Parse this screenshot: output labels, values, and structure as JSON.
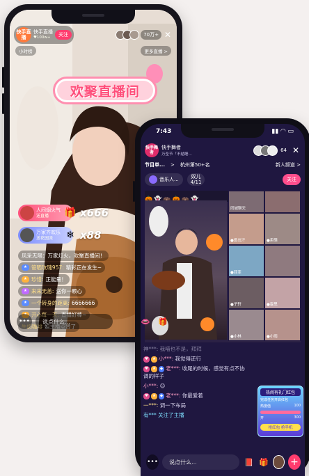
{
  "phone_a": {
    "anchor_name": "快手直播",
    "anchor_sub": "♥100w+",
    "avatar_text": "快手直播",
    "follow_label": "关注",
    "viewer_count": "70万+",
    "hour_rank": "小时榜",
    "more_live": "更多直播 >",
    "banner_text": "欢聚直播间",
    "gifts": [
      {
        "name": "人间烟火气",
        "sub": "送直播",
        "count": "x666",
        "icon": "gift-icon"
      },
      {
        "name": "万家齐欢乐",
        "sub": "送花园派",
        "count": "x88",
        "icon": "snowflake-icon"
      }
    ],
    "chat": [
      {
        "level": "",
        "user": "",
        "text": "风采无限：万家灯火，欢聚直播间！"
      },
      {
        "level": "",
        "user": "管晒玫瑰957:",
        "text": "精彩正在发生~"
      },
      {
        "level": "",
        "user": "珍惜:",
        "text": "正能量！"
      },
      {
        "level": "",
        "user": "来来无恙:",
        "text": "送你一颗心"
      },
      {
        "level": "",
        "user": "一个转身的距离:",
        "text": "6666666"
      },
      {
        "level": "",
        "user": "开心每一天:",
        "text": "直播好棒~"
      },
      {
        "level": "",
        "user": "牛奶咖啡",
        "text": "姐主播点赞了"
      }
    ],
    "input_placeholder": "说点什么..."
  },
  "phone_b": {
    "time": "7:43",
    "anchor_name": "快手舞者",
    "anchor_sub": "万圣节「不结睡...",
    "avatar_text": "快手舞者",
    "viewer_num": "64",
    "tabs": [
      "节目单...",
      ">",
      "杭州第50+名",
      "新人频道 >"
    ],
    "row3": {
      "room_label": "音乐人...",
      "chip_title": "奴儿",
      "chip_date": "4/11",
      "follow": "关注"
    },
    "grid_tiles": [
      {
        "label": "同城聊天"
      },
      {
        "label": ""
      },
      {
        "label": "●爱出汗"
      },
      {
        "label": "●卖萌"
      },
      {
        "label": "●菲菲"
      },
      {
        "label": ""
      },
      {
        "label": "●子轩"
      },
      {
        "label": "●姿思"
      },
      {
        "label": "●小林"
      },
      {
        "label": "●小雨"
      }
    ],
    "chat": [
      {
        "type": "faded",
        "text": "神***: 我喵也不是，拜拜"
      },
      {
        "type": "lv",
        "user": "小***:",
        "text": "我觉得还行"
      },
      {
        "type": "lv",
        "user": "老***:",
        "text": "收尾的时候，感觉有点不协调的样子"
      },
      {
        "type": "lv",
        "user": "小***:",
        "text": "😊"
      },
      {
        "type": "lv",
        "user": "老***:",
        "text": "你最爱着"
      },
      {
        "type": "plain",
        "user": "一***:",
        "text": "调一下布局"
      },
      {
        "type": "sys",
        "user": "有***",
        "text": "关注了主播"
      }
    ],
    "rank_card": {
      "title": "热闹有礼门红包",
      "line1": "完成任务开启红包",
      "label_a": "热度值",
      "val_a": "100",
      "label_b": "开",
      "val_b": "300",
      "btn": "抢红包 抢手机"
    },
    "input_placeholder": "说点什么..."
  }
}
